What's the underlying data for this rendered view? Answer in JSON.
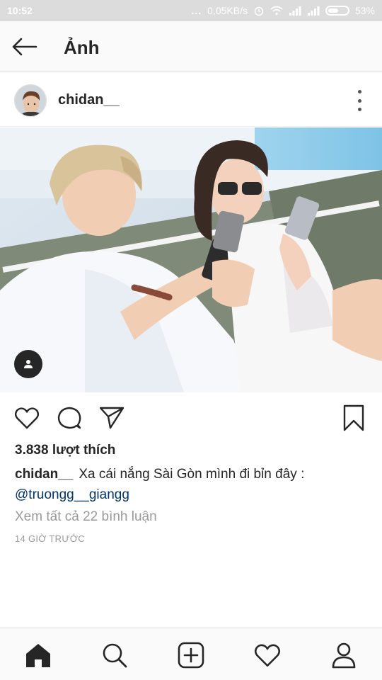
{
  "status_bar": {
    "time": "10:52",
    "network_speed": "0,05KB/s",
    "battery": "53%"
  },
  "app_bar": {
    "title": "Ảnh",
    "back_icon": "arrow-left-icon"
  },
  "post": {
    "username": "chidan__",
    "likes": "3.838 lượt thích",
    "caption_user": "chidan__",
    "caption_text": "Xa cái nắng Sài Gòn mình đi bỉn đây :",
    "mention": "@truongg__giangg",
    "view_comments": "Xem tất cả 22 bình luận",
    "timestamp": "14 GIỜ TRƯỚC"
  },
  "actions": [
    "heart-icon",
    "comment-icon",
    "share-icon",
    "bookmark-icon"
  ],
  "bottom_nav": [
    "home-icon",
    "search-icon",
    "add-icon",
    "activity-heart-icon",
    "profile-icon"
  ],
  "colors": {
    "text": "#262626",
    "secondary": "#999999",
    "link": "#003569",
    "status_bar": "#dcdcdc"
  }
}
